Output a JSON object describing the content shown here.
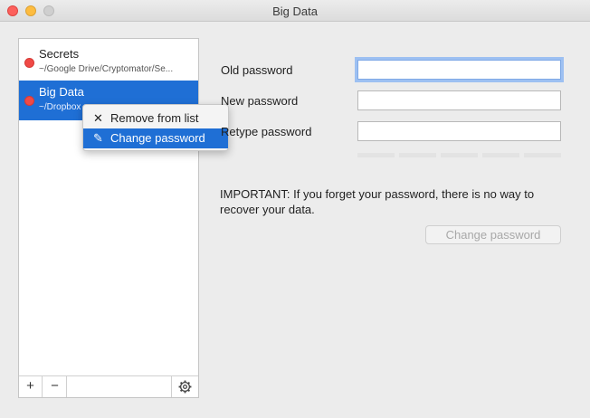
{
  "window": {
    "title": "Big Data"
  },
  "vaults": [
    {
      "name": "Secrets",
      "path": "~/Google Drive/Cryptomator/Se..."
    },
    {
      "name": "Big Data",
      "path": "~/Dropbox"
    }
  ],
  "sidebar_toolbar": {
    "add": "+",
    "remove": "−"
  },
  "context_menu": {
    "items": [
      {
        "label": "Remove from list",
        "icon": "✕",
        "icon_name": "close-icon"
      },
      {
        "label": "Change password",
        "icon": "✎",
        "icon_name": "pencil-icon"
      }
    ]
  },
  "form": {
    "old_password_label": "Old password",
    "new_password_label": "New password",
    "retype_password_label": "Retype password",
    "old_password_value": "",
    "new_password_value": "",
    "retype_password_value": "",
    "important_text": "IMPORTANT: If you forget your password, there is no way to recover your data.",
    "submit_label": "Change password"
  },
  "colors": {
    "selection": "#1f6fd5",
    "vault_dot": "#f04a46"
  }
}
